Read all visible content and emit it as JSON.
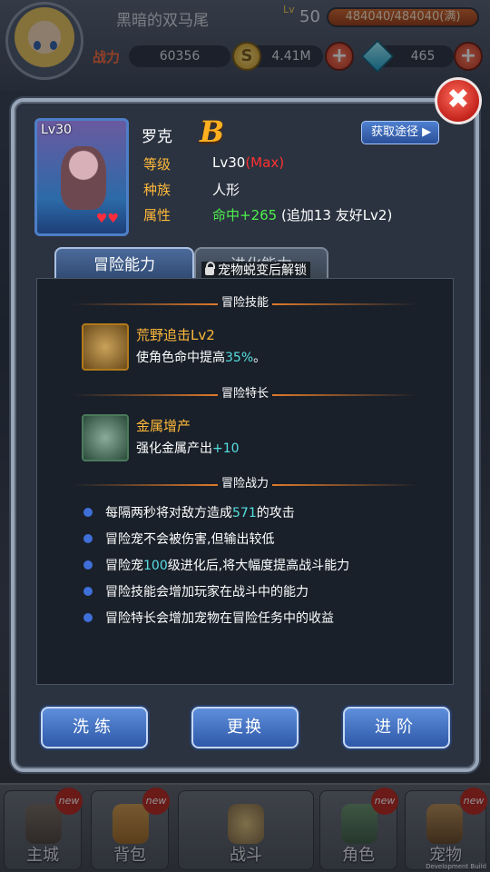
{
  "topbar": {
    "player_name": "黑暗的双马尾",
    "lv_label": "Lv",
    "level": "50",
    "exp_text": "484040/484040(满)",
    "power_label": "战力",
    "power_value": "60356",
    "coin_value": "4.41M",
    "gem_value": "465"
  },
  "dialog": {
    "portrait_level": "Lv30",
    "pet_name": "罗克",
    "grade": "B",
    "level_label": "等级",
    "level_value": "Lv30",
    "level_max": "(Max)",
    "race_label": "种族",
    "race_value": "人形",
    "attr_label": "属性",
    "attr_value": "命中+265",
    "attr_extra": "(追加13  友好Lv2)",
    "get_button": "获取途径",
    "tab_active": "冒险能力",
    "tab_inactive": "进化能力",
    "lock_text": "宠物蜕变后解锁",
    "section_skill": "冒险技能",
    "skill_name": "荒野追击Lv2",
    "skill_desc_pre": "使角色命中提高",
    "skill_desc_val": "35%",
    "skill_desc_post": "。",
    "section_specialty": "冒险特长",
    "specialty_name": "金属增产",
    "specialty_desc_pre": "强化金属产出",
    "specialty_desc_val": "+10",
    "section_power": "冒险战力",
    "bullets": [
      {
        "pre": "每隔两秒将对敌方造成",
        "val": "571",
        "post": "的攻击"
      },
      {
        "pre": "冒险宠不会被伤害,但输出较低",
        "val": "",
        "post": ""
      },
      {
        "pre": "冒险宠",
        "val": "100",
        "post": "级进化后,将大幅度提高战斗能力"
      },
      {
        "pre": "冒险技能会增加玩家在战斗中的能力",
        "val": "",
        "post": ""
      },
      {
        "pre": "冒险特长会增加宠物在冒险任务中的收益",
        "val": "",
        "post": ""
      }
    ],
    "btn_refine": "洗练",
    "btn_replace": "更换",
    "btn_advance": "进阶"
  },
  "nav": {
    "items": [
      {
        "label": "主城",
        "new": "new"
      },
      {
        "label": "背包",
        "new": "new"
      },
      {
        "label": "战斗",
        "new": ""
      },
      {
        "label": "角色",
        "new": "new"
      },
      {
        "label": "宠物",
        "new": "new"
      }
    ]
  },
  "dev_build": "Development Build",
  "colors": {
    "accent_orange": "#ffb93a",
    "highlight_cyan": "#56e0e0",
    "attr_green": "#4df04d",
    "max_red": "#ff3030",
    "button_blue": "#2e58a8"
  }
}
